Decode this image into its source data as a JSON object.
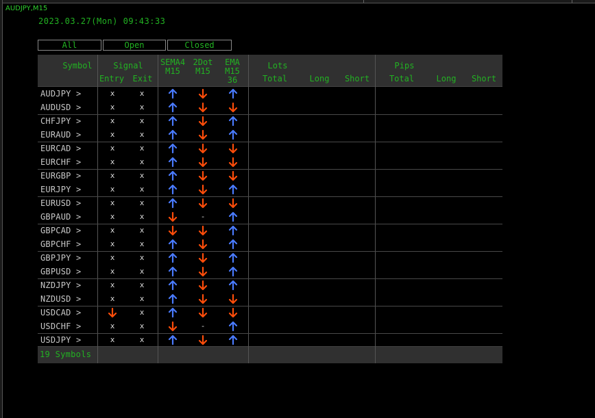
{
  "chart_title": "AUDJPY,M15",
  "datetime": "2023.03.27(Mon) 09:43:33",
  "tabs": [
    "All",
    "Open",
    "Closed"
  ],
  "headers": {
    "symbol": "Symbol",
    "signal": "Signal",
    "entry": "Entry",
    "exit": "Exit",
    "sema4_a": "SEMA4",
    "sema4_b": "M15",
    "dot_a": "2Dot",
    "dot_b": "M15",
    "ema_a": "EMA",
    "ema_b": "M15",
    "ema_c": "36",
    "lots": "Lots",
    "lots_total": "Total",
    "lots_long": "Long",
    "lots_short": "Short",
    "pips": "Pips",
    "pips_total": "Total",
    "pips_long": "Long",
    "pips_short": "Short"
  },
  "colors": {
    "up": "#4a7bff",
    "down": "#ff4d0a",
    "text_green": "#22b222"
  },
  "rows": [
    {
      "symbol": "AUDJPY >",
      "entry": "x",
      "exit": "x",
      "sema4": "up",
      "dot": "down",
      "ema": "up"
    },
    {
      "symbol": "AUDUSD >",
      "entry": "x",
      "exit": "x",
      "sema4": "up",
      "dot": "down",
      "ema": "down"
    },
    {
      "symbol": "CHFJPY >",
      "entry": "x",
      "exit": "x",
      "sema4": "up",
      "dot": "down",
      "ema": "up"
    },
    {
      "symbol": "EURAUD >",
      "entry": "x",
      "exit": "x",
      "sema4": "up",
      "dot": "down",
      "ema": "up"
    },
    {
      "symbol": "EURCAD >",
      "entry": "x",
      "exit": "x",
      "sema4": "up",
      "dot": "down",
      "ema": "down"
    },
    {
      "symbol": "EURCHF >",
      "entry": "x",
      "exit": "x",
      "sema4": "up",
      "dot": "down",
      "ema": "down"
    },
    {
      "symbol": "EURGBP >",
      "entry": "x",
      "exit": "x",
      "sema4": "up",
      "dot": "down",
      "ema": "down"
    },
    {
      "symbol": "EURJPY >",
      "entry": "x",
      "exit": "x",
      "sema4": "up",
      "dot": "down",
      "ema": "up"
    },
    {
      "symbol": "EURUSD >",
      "entry": "x",
      "exit": "x",
      "sema4": "up",
      "dot": "down",
      "ema": "down"
    },
    {
      "symbol": "GBPAUD >",
      "entry": "x",
      "exit": "x",
      "sema4": "down",
      "dot": "-",
      "ema": "up"
    },
    {
      "symbol": "GBPCAD >",
      "entry": "x",
      "exit": "x",
      "sema4": "down",
      "dot": "down",
      "ema": "up"
    },
    {
      "symbol": "GBPCHF >",
      "entry": "x",
      "exit": "x",
      "sema4": "up",
      "dot": "down",
      "ema": "up"
    },
    {
      "symbol": "GBPJPY >",
      "entry": "x",
      "exit": "x",
      "sema4": "up",
      "dot": "down",
      "ema": "up"
    },
    {
      "symbol": "GBPUSD >",
      "entry": "x",
      "exit": "x",
      "sema4": "up",
      "dot": "down",
      "ema": "up"
    },
    {
      "symbol": "NZDJPY >",
      "entry": "x",
      "exit": "x",
      "sema4": "up",
      "dot": "down",
      "ema": "up"
    },
    {
      "symbol": "NZDUSD >",
      "entry": "x",
      "exit": "x",
      "sema4": "up",
      "dot": "down",
      "ema": "down"
    },
    {
      "symbol": "USDCAD >",
      "entry": "down",
      "exit": "x",
      "sema4": "up",
      "dot": "down",
      "ema": "down"
    },
    {
      "symbol": "USDCHF >",
      "entry": "x",
      "exit": "x",
      "sema4": "down",
      "dot": "-",
      "ema": "up"
    },
    {
      "symbol": "USDJPY >",
      "entry": "x",
      "exit": "x",
      "sema4": "up",
      "dot": "down",
      "ema": "up"
    }
  ],
  "footer": "19 Symbols"
}
